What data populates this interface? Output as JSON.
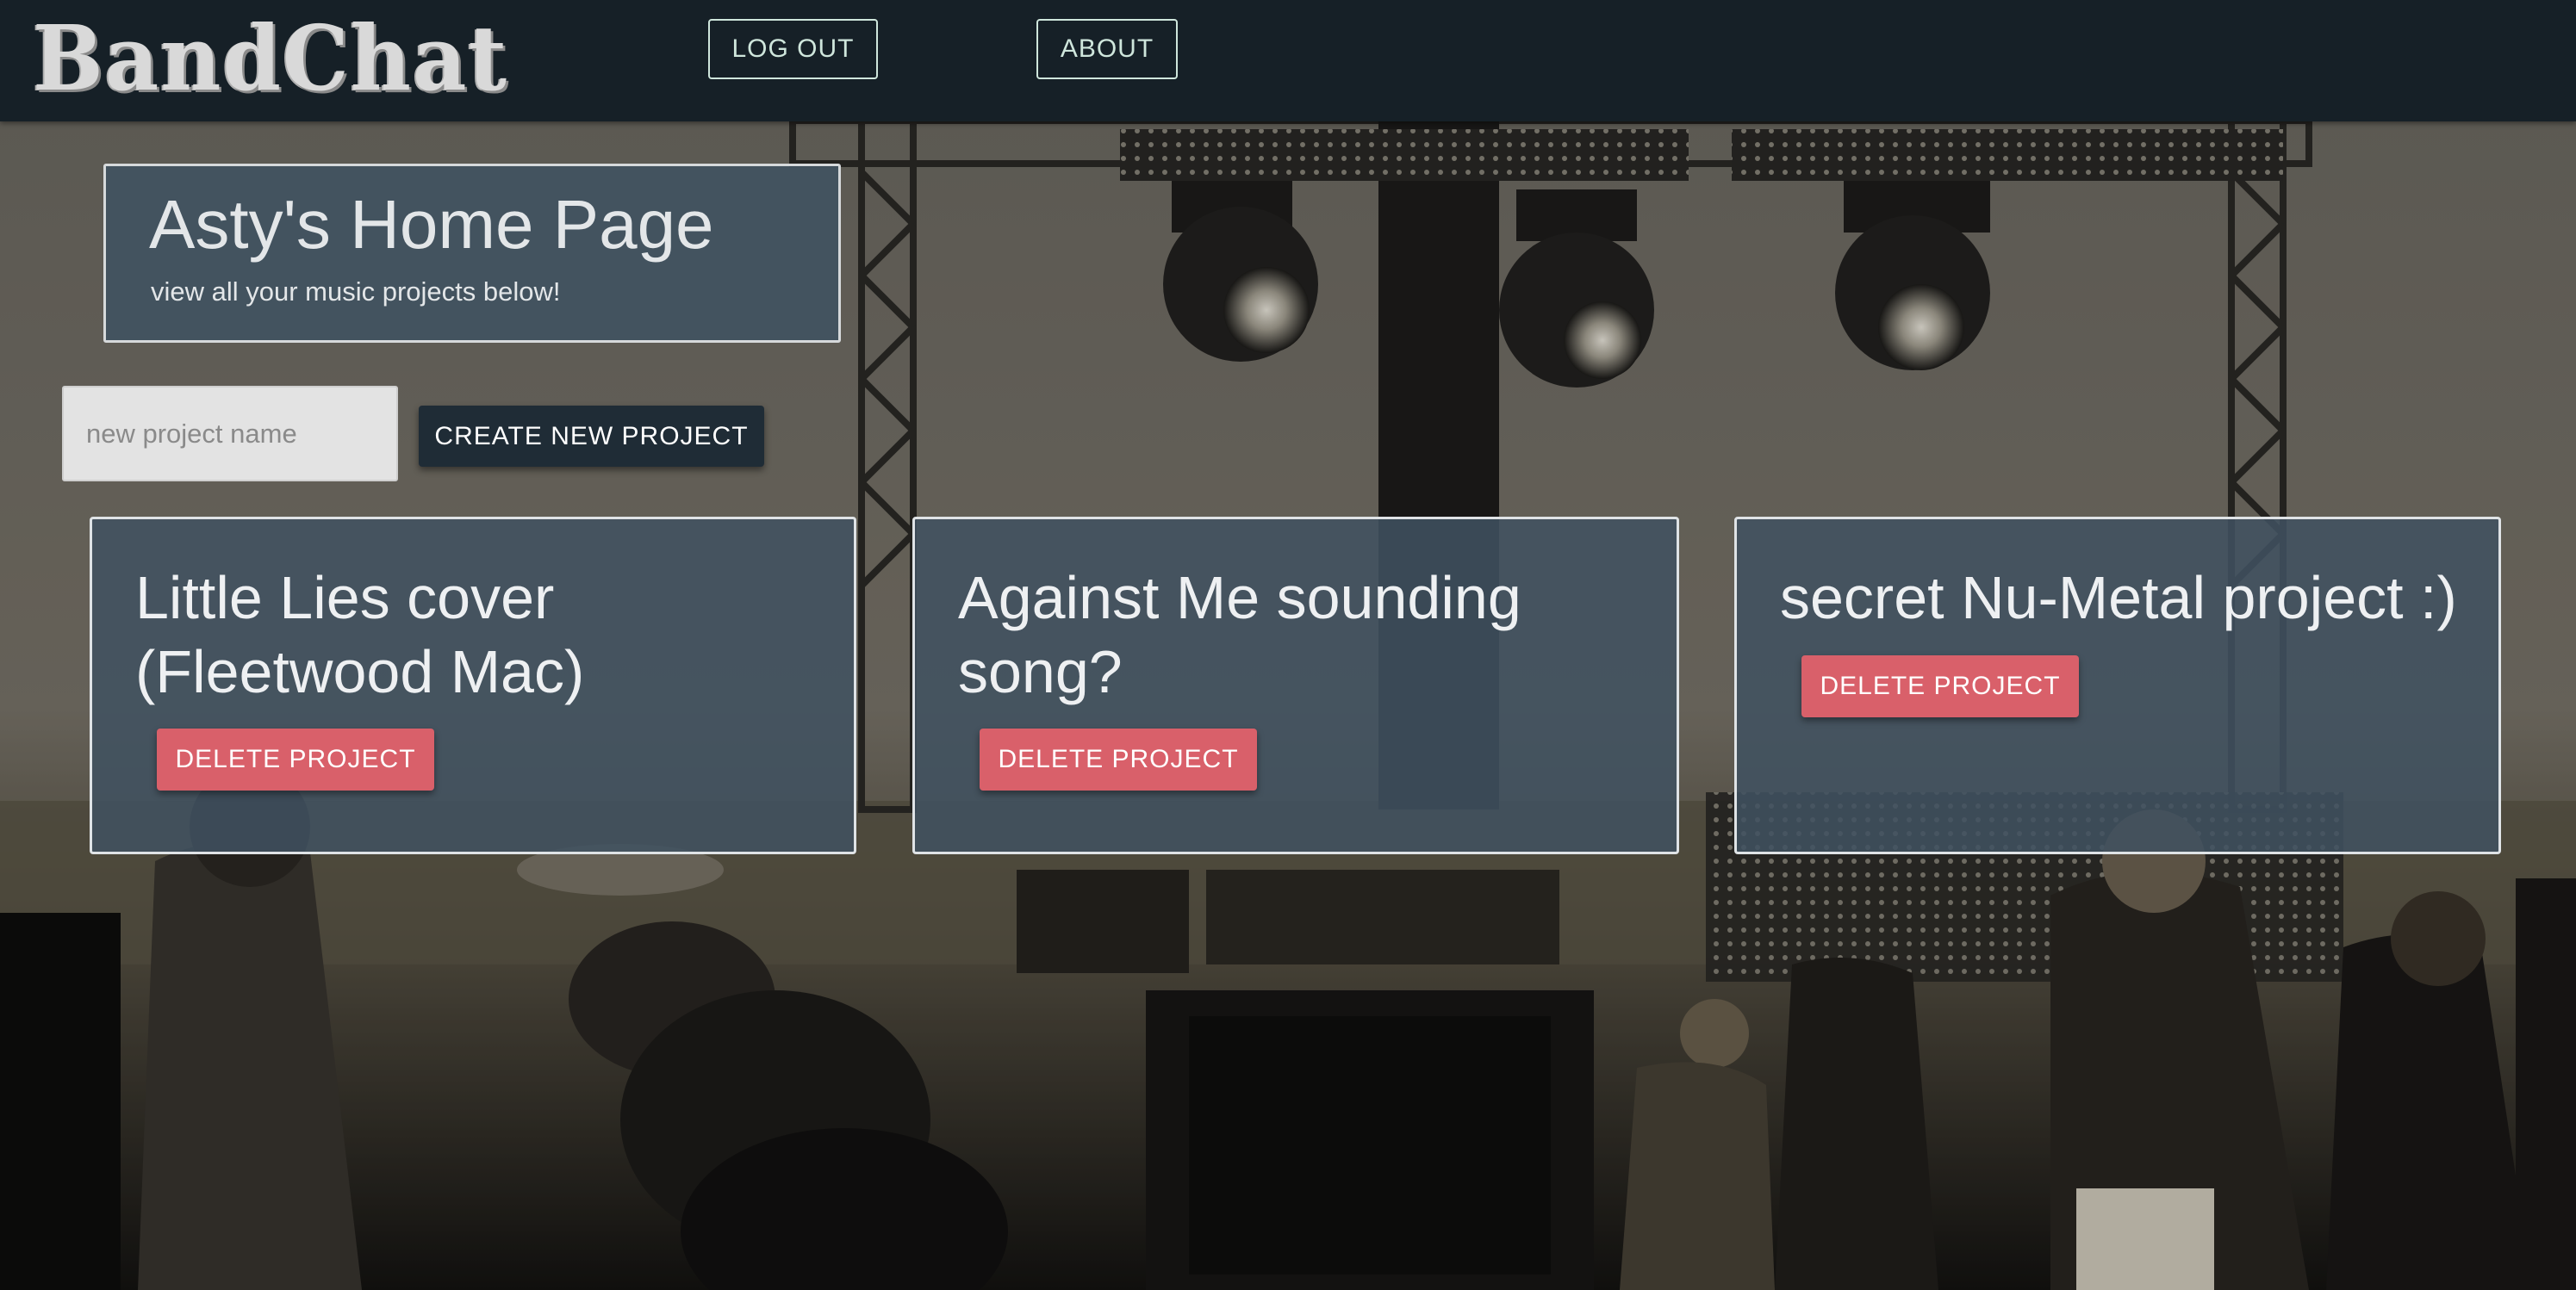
{
  "header": {
    "logo_text": "BandChat",
    "logout_label": "LOG OUT",
    "about_label": "ABOUT"
  },
  "home": {
    "title": "Asty's Home Page",
    "subtitle": "view all your music projects below!"
  },
  "new_project": {
    "placeholder": "new project name",
    "value": "",
    "create_label": "CREATE NEW PROJECT"
  },
  "projects": [
    {
      "name": "Little Lies cover (Fleetwood Mac)",
      "delete_label": "DELETE PROJECT"
    },
    {
      "name": "Against Me sounding song?",
      "delete_label": "DELETE PROJECT"
    },
    {
      "name": "secret Nu-Metal project :)",
      "delete_label": "DELETE PROJECT"
    }
  ],
  "colors": {
    "navbar": "#162027",
    "card_bg": "#405261",
    "delete_button": "#d9606a",
    "create_button": "#1f2c36",
    "nav_button_border": "#cfe6dc"
  }
}
